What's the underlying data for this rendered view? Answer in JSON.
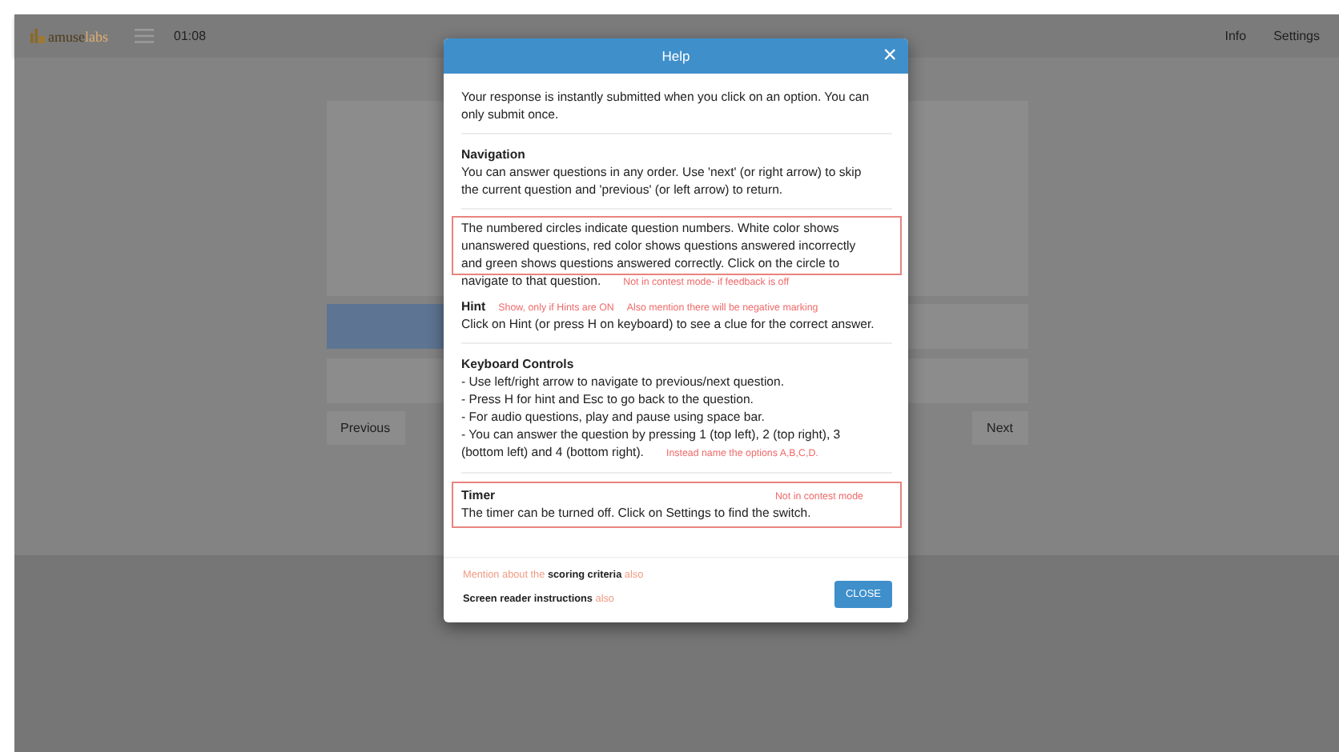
{
  "app": {
    "logo_parts": [
      "amuse",
      "labs"
    ],
    "timer": "01:08",
    "menu": [
      "Info",
      "Settings"
    ]
  },
  "backdrop": {
    "previous": "Previous",
    "next": "Next"
  },
  "modal": {
    "title": "Help",
    "close_glyph": "×",
    "sections": [
      {
        "kind": "plain",
        "lines": [
          "Your response is instantly submitted when you click on an option. You can",
          "only submit once."
        ]
      },
      {
        "kind": "plain",
        "heading": "Navigation",
        "lines": [
          "You can answer questions in any order. Use 'next' (or right arrow) to skip",
          "the current question and 'previous' (or left arrow) to return."
        ]
      },
      {
        "kind": "partly_boxed",
        "lines": [
          "The numbered circles indicate question numbers. White color shows",
          "unanswered questions, red color shows questions answered incorrectly",
          "and green shows questions answered correctly. Click on the circle to",
          "navigate to that question."
        ],
        "note": "Not in contest mode- if feedback is off"
      },
      {
        "kind": "plain",
        "heading": "Hint",
        "heading_notes": [
          "Show, only if Hints are ON",
          "Also mention there will be negative marking"
        ],
        "text": "Click on Hint (or press H on keyboard) to see a clue for the correct answer."
      },
      {
        "kind": "plain",
        "heading": "Keyboard Controls",
        "lines": [
          "- Use left/right arrow to navigate to previous/next question.",
          "- Press H for hint and Esc to go back to the question.",
          "- For audio questions, play and pause using space bar.",
          "- You can answer the question by pressing 1 (top left), 2 (top right), 3",
          "(bottom left) and 4 (bottom right)."
        ],
        "note": "Instead name the options A,B,C,D."
      },
      {
        "kind": "boxed",
        "heading": "Timer",
        "heading_notes": [
          "Not in contest mode"
        ],
        "text": "The timer can be turned off. Click on Settings to find the switch."
      }
    ],
    "footer_notes": [
      "Mention about the **scoring criteria** also",
      "**Screen reader instructions** also"
    ],
    "close_button": "CLOSE"
  }
}
